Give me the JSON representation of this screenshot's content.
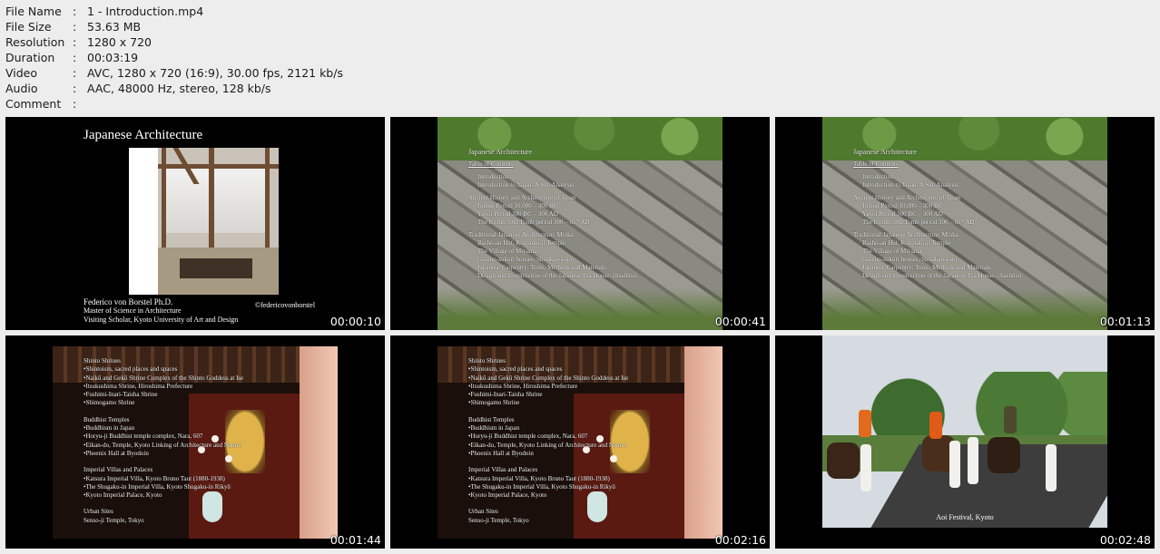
{
  "metadata": [
    {
      "key": "File Name",
      "value": "1 - Introduction.mp4"
    },
    {
      "key": "File Size",
      "value": "53.63 MB"
    },
    {
      "key": "Resolution",
      "value": "1280 x 720"
    },
    {
      "key": "Duration",
      "value": "00:03:19"
    },
    {
      "key": "Video",
      "value": "AVC, 1280 x 720 (16:9), 30.00 fps, 2121 kb/s"
    },
    {
      "key": "Audio",
      "value": "AAC, 48000 Hz, stereo, 128 kb/s"
    },
    {
      "key": "Comment",
      "value": ""
    }
  ],
  "separator": ":",
  "thumbs": [
    {
      "timestamp": "00:00:10"
    },
    {
      "timestamp": "00:00:41"
    },
    {
      "timestamp": "00:01:13"
    },
    {
      "timestamp": "00:01:44"
    },
    {
      "timestamp": "00:02:16"
    },
    {
      "timestamp": "00:02:48"
    }
  ],
  "slide1": {
    "title": "Japanese Architecture",
    "author": "Federico von Borstel Ph.D.",
    "degree": "Master of Science in Architecture",
    "position": "Visiting Scholar, Kyoto University of Art and Design",
    "copyright": "©federicovonborstel"
  },
  "toc": {
    "heading": "Japanese Architecture",
    "sub": "Table of Contents",
    "intro": "Introduction",
    "intro2": "Introduction to Japan: A Site Analysis",
    "ancient": "Ancient History and Architecture of Japan",
    "jomon": "Jomon Period 10,000 – 300 BC",
    "yayoi": "Yayoi Period 300 BC – 300 AD",
    "kofun": "The Kofun: Old Tomb period 300 – 657 AD",
    "traditional": "Traditional Japanese Architecture: Minka",
    "basho": "Basho-an Hut, Konpuku-ji Temple",
    "village": "The Village of Miyama",
    "gassho": "Gassho-zukuri houses, Shirakawa-go",
    "carpentry": "Japanese Carpentry: Tools, Methods and Materials",
    "teahouse": "Design and Construction of the Japanese Tea House: chashitsu"
  },
  "shrines": {
    "shinto": "Shinto Shrines",
    "s1": "•Shintoism, sacred places and spaces",
    "s2": "•Naikū and Gekū Shrine Complex of the Shinto Goddess at Ise",
    "s3": "•Itsukushima Shrine, Hiroshima Prefecture",
    "s4": "•Fushimi-Inari-Taisha Shrine",
    "s5": "•Shimogamo Shrine",
    "buddhist": "Buddhist Temples",
    "b1": "•Buddhism in Japan",
    "b2": "•Horyu-ji Buddhist temple complex, Nara, 607",
    "b3": "•Eikan-do, Temple, Kyoto Linking of Architecture and Nature",
    "b4": "•Phoenix Hall at Byodoin",
    "imperial": "Imperial Villas and Palaces",
    "i1": "•Katsura Imperial Villa, Kyoto Bruno Taut (1880-1938)",
    "i2": "•The Shugaku-in Imperial Villa, Kyoto Shugaku-in Rikyū",
    "i3": "•Kyoto Imperial Palace, Kyoto",
    "urban": "Urban Sites",
    "u1": "Senso-ji Temple, Tokyo"
  },
  "festival": {
    "caption": "Aoi Festival, Kyoto"
  }
}
